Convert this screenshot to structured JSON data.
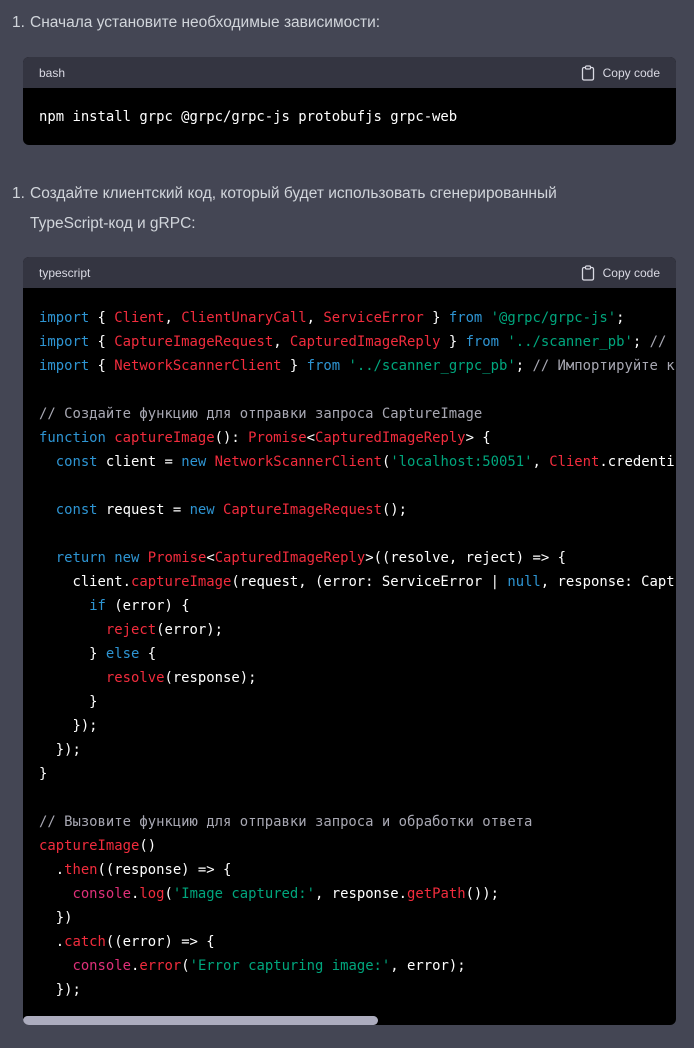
{
  "step1": {
    "number": "1.",
    "text": "Сначала установите необходимые зависимости:"
  },
  "block1": {
    "language": "bash",
    "copy_label": "Copy code",
    "lines": [
      [
        [
          "pl",
          "npm install grpc @grpc/grpc-js protobufjs grpc-web"
        ]
      ]
    ]
  },
  "step2": {
    "number": "1.",
    "text": "Создайте клиентский код, который будет использовать сгенерированный TypeScript-код и gRPC:"
  },
  "block2": {
    "language": "typescript",
    "copy_label": "Copy code",
    "scroll_position": 0,
    "lines": [
      [
        [
          "kw",
          "import"
        ],
        [
          "pl",
          " { "
        ],
        [
          "cls",
          "Client"
        ],
        [
          "pl",
          ", "
        ],
        [
          "cls",
          "ClientUnaryCall"
        ],
        [
          "pl",
          ", "
        ],
        [
          "cls",
          "ServiceError"
        ],
        [
          "pl",
          " } "
        ],
        [
          "kw",
          "from"
        ],
        [
          "pl",
          " "
        ],
        [
          "str",
          "'@grpc/grpc-js'"
        ],
        [
          "pl",
          ";"
        ]
      ],
      [
        [
          "kw",
          "import"
        ],
        [
          "pl",
          " { "
        ],
        [
          "cls",
          "CaptureImageRequest"
        ],
        [
          "pl",
          ", "
        ],
        [
          "cls",
          "CapturedImageReply"
        ],
        [
          "pl",
          " } "
        ],
        [
          "kw",
          "from"
        ],
        [
          "pl",
          " "
        ],
        [
          "str",
          "'../scanner_pb'"
        ],
        [
          "pl",
          "; "
        ],
        [
          "cm",
          "//"
        ]
      ],
      [
        [
          "kw",
          "import"
        ],
        [
          "pl",
          " { "
        ],
        [
          "cls",
          "NetworkScannerClient"
        ],
        [
          "pl",
          " } "
        ],
        [
          "kw",
          "from"
        ],
        [
          "pl",
          " "
        ],
        [
          "str",
          "'../scanner_grpc_pb'"
        ],
        [
          "pl",
          "; "
        ],
        [
          "cm",
          "// Импортируйте к"
        ]
      ],
      [],
      [
        [
          "cm",
          "// Создайте функцию для отправки запроса CaptureImage"
        ]
      ],
      [
        [
          "kw",
          "function"
        ],
        [
          "pl",
          " "
        ],
        [
          "fn",
          "captureImage"
        ],
        [
          "pl",
          "(): "
        ],
        [
          "cls",
          "Promise"
        ],
        [
          "pl",
          "<"
        ],
        [
          "cls",
          "CapturedImageReply"
        ],
        [
          "pl",
          "> {"
        ]
      ],
      [
        [
          "pl",
          "  "
        ],
        [
          "kw",
          "const"
        ],
        [
          "pl",
          " client = "
        ],
        [
          "kw",
          "new"
        ],
        [
          "pl",
          " "
        ],
        [
          "cls",
          "NetworkScannerClient"
        ],
        [
          "pl",
          "("
        ],
        [
          "str",
          "'localhost:50051'"
        ],
        [
          "pl",
          ", "
        ],
        [
          "cls",
          "Client"
        ],
        [
          "pl",
          ".credenti"
        ]
      ],
      [],
      [
        [
          "pl",
          "  "
        ],
        [
          "kw",
          "const"
        ],
        [
          "pl",
          " request = "
        ],
        [
          "kw",
          "new"
        ],
        [
          "pl",
          " "
        ],
        [
          "cls",
          "CaptureImageRequest"
        ],
        [
          "pl",
          "();"
        ]
      ],
      [],
      [
        [
          "pl",
          "  "
        ],
        [
          "kw",
          "return"
        ],
        [
          "pl",
          " "
        ],
        [
          "kw",
          "new"
        ],
        [
          "pl",
          " "
        ],
        [
          "cls",
          "Promise"
        ],
        [
          "pl",
          "<"
        ],
        [
          "cls",
          "CapturedImageReply"
        ],
        [
          "pl",
          ">((resolve, reject) => {"
        ]
      ],
      [
        [
          "pl",
          "    client."
        ],
        [
          "fn",
          "captureImage"
        ],
        [
          "pl",
          "(request, (error: ServiceError | "
        ],
        [
          "kw",
          "null"
        ],
        [
          "pl",
          ", response: Capt"
        ]
      ],
      [
        [
          "pl",
          "      "
        ],
        [
          "kw",
          "if"
        ],
        [
          "pl",
          " (error) {"
        ]
      ],
      [
        [
          "pl",
          "        "
        ],
        [
          "fn",
          "reject"
        ],
        [
          "pl",
          "(error);"
        ]
      ],
      [
        [
          "pl",
          "      } "
        ],
        [
          "kw",
          "else"
        ],
        [
          "pl",
          " {"
        ]
      ],
      [
        [
          "pl",
          "        "
        ],
        [
          "fn",
          "resolve"
        ],
        [
          "pl",
          "(response);"
        ]
      ],
      [
        [
          "pl",
          "      }"
        ]
      ],
      [
        [
          "pl",
          "    });"
        ]
      ],
      [
        [
          "pl",
          "  });"
        ]
      ],
      [
        [
          "pl",
          "}"
        ]
      ],
      [],
      [
        [
          "cm",
          "// Вызовите функцию для отправки запроса и обработки ответа"
        ]
      ],
      [
        [
          "fn",
          "captureImage"
        ],
        [
          "pl",
          "()"
        ]
      ],
      [
        [
          "pl",
          "  ."
        ],
        [
          "fn",
          "then"
        ],
        [
          "pl",
          "((response) => {"
        ]
      ],
      [
        [
          "pl",
          "    "
        ],
        [
          "obj",
          "console"
        ],
        [
          "pl",
          "."
        ],
        [
          "fn",
          "log"
        ],
        [
          "pl",
          "("
        ],
        [
          "str",
          "'Image captured:'"
        ],
        [
          "pl",
          ", response."
        ],
        [
          "fn",
          "getPath"
        ],
        [
          "pl",
          "());"
        ]
      ],
      [
        [
          "pl",
          "  })"
        ]
      ],
      [
        [
          "pl",
          "  ."
        ],
        [
          "fn",
          "catch"
        ],
        [
          "pl",
          "((error) => {"
        ]
      ],
      [
        [
          "pl",
          "    "
        ],
        [
          "obj",
          "console"
        ],
        [
          "pl",
          "."
        ],
        [
          "fn",
          "error"
        ],
        [
          "pl",
          "("
        ],
        [
          "str",
          "'Error capturing image:'"
        ],
        [
          "pl",
          ", error);"
        ]
      ],
      [
        [
          "pl",
          "  });"
        ]
      ]
    ]
  },
  "colors": {
    "background": "#444654",
    "code_bg": "#000000",
    "code_header": "#343541",
    "keyword": "#2e95d3",
    "class": "#f22c3d",
    "string": "#00a67d",
    "comment": "#a8a8b3"
  }
}
